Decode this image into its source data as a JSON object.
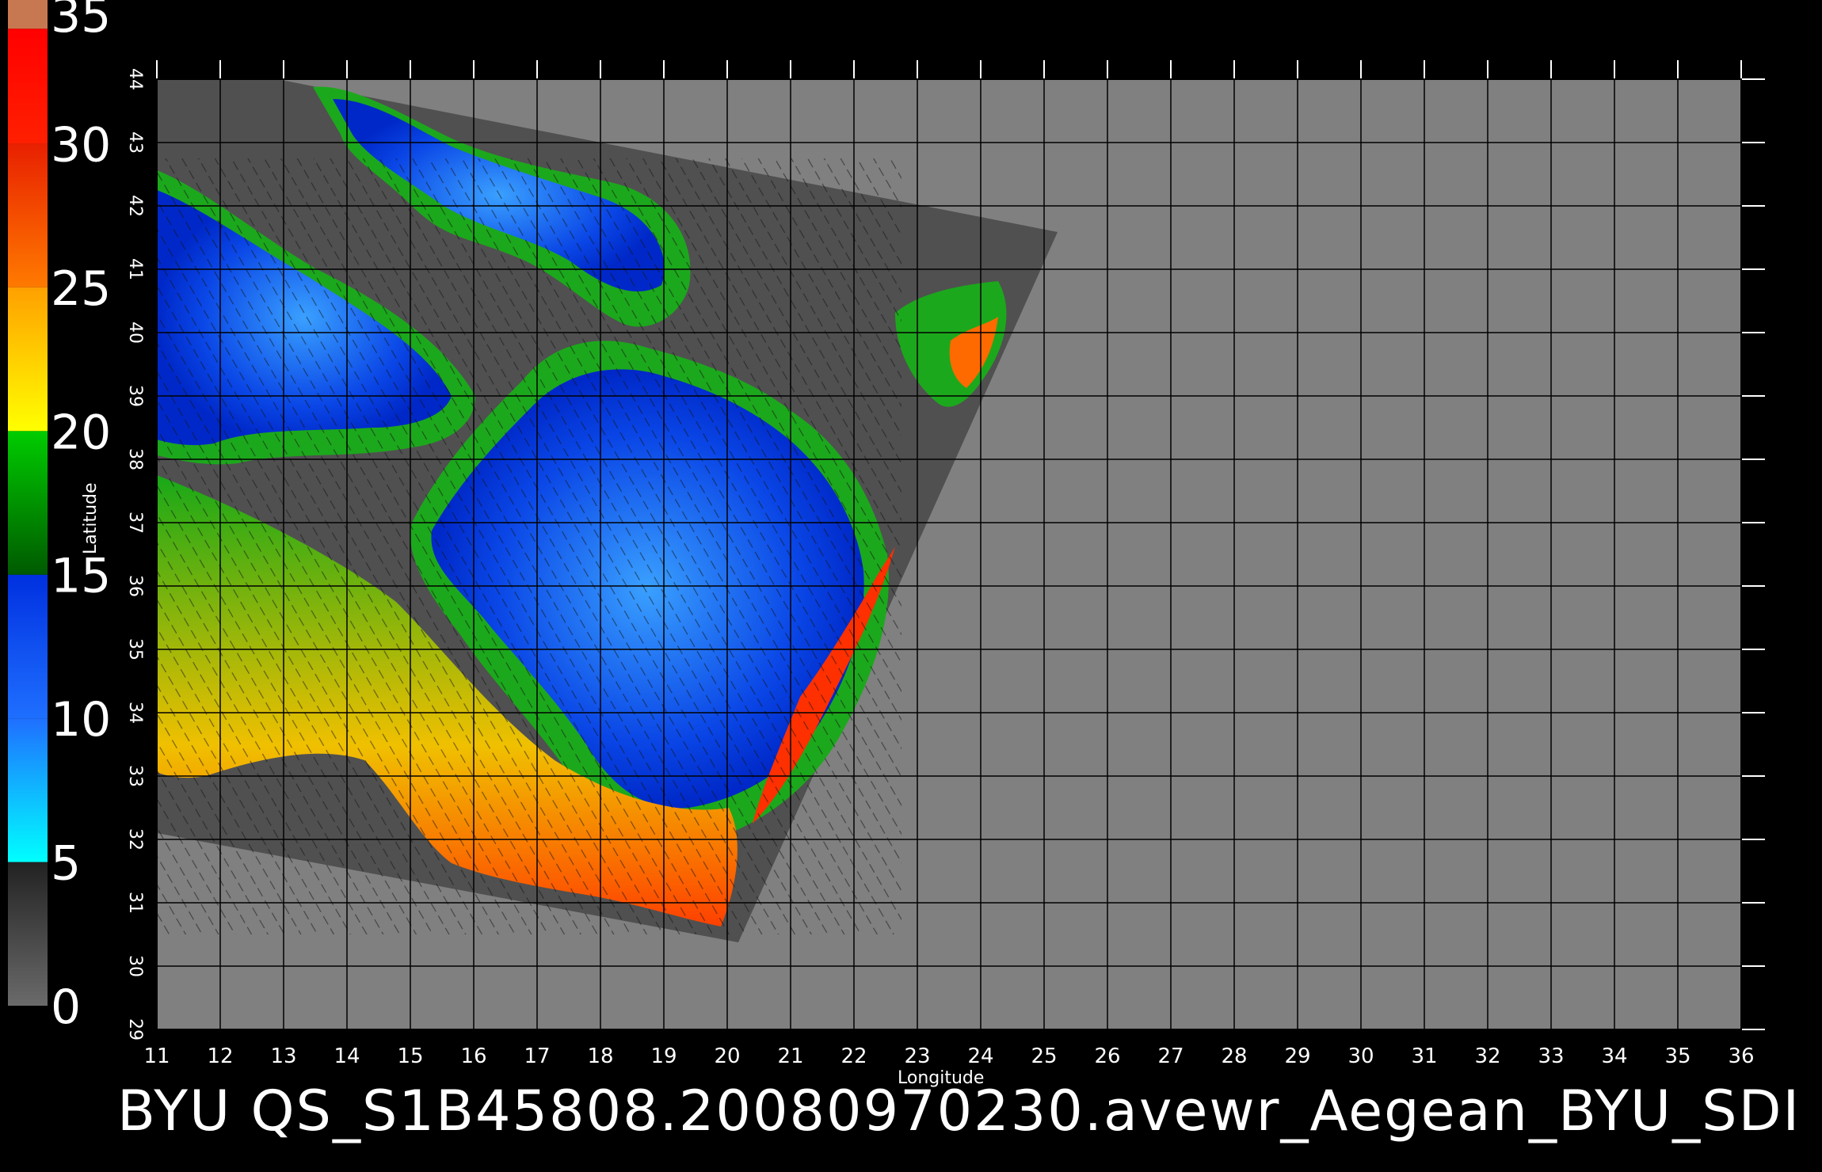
{
  "map": {
    "caption": "BYU QS_S1B45808.20080970230.avewr_Aegean_BYU_SDI",
    "xlabel": "Longitude",
    "ylabel": "Latitude",
    "lon_range": [
      11,
      36
    ],
    "lat_range": [
      29,
      44
    ],
    "lon_ticks": [
      "11",
      "12",
      "13",
      "14",
      "15",
      "16",
      "17",
      "18",
      "19",
      "20",
      "21",
      "22",
      "23",
      "24",
      "25",
      "26",
      "27",
      "28",
      "29",
      "30",
      "31",
      "32",
      "33",
      "34",
      "35",
      "36"
    ],
    "lat_ticks": [
      "29",
      "30",
      "31",
      "32",
      "33",
      "34",
      "35",
      "36",
      "37",
      "38",
      "39",
      "40",
      "41",
      "42",
      "43",
      "44"
    ],
    "grid": true,
    "background_color": "#808080",
    "swath_color": "#505050"
  },
  "colorbar": {
    "labels": [
      "0",
      "5",
      "10",
      "15",
      "20",
      "25",
      "30",
      "35"
    ],
    "range": [
      0,
      35
    ],
    "segments": [
      {
        "from": 0,
        "to": 5,
        "colors": [
          "#6a6a6a",
          "#222222"
        ]
      },
      {
        "from": 5,
        "to": 10,
        "colors": [
          "#00ffff",
          "#1f6fff"
        ]
      },
      {
        "from": 10,
        "to": 15,
        "colors": [
          "#1f6fff",
          "#0030e0"
        ]
      },
      {
        "from": 15,
        "to": 20,
        "colors": [
          "#005a00",
          "#00cc00"
        ]
      },
      {
        "from": 20,
        "to": 25,
        "colors": [
          "#ffff00",
          "#ffa000"
        ]
      },
      {
        "from": 25,
        "to": 30,
        "colors": [
          "#ff7a00",
          "#e82000"
        ]
      },
      {
        "from": 30,
        "to": 34,
        "colors": [
          "#ff2000",
          "#ff0000"
        ]
      },
      {
        "from": 34,
        "to": 35,
        "colors": [
          "#c87850",
          "#c87850"
        ]
      }
    ]
  }
}
